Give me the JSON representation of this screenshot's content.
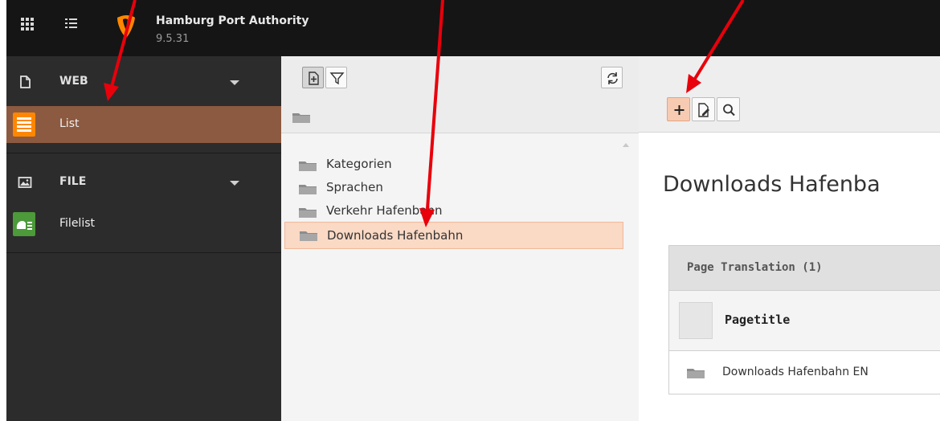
{
  "topbar": {
    "site_name": "Hamburg Port Authority",
    "version": "9.5.31"
  },
  "module_menu": {
    "groups": [
      {
        "label": "WEB",
        "icon": "document-icon",
        "modules": [
          {
            "label": "List",
            "icon": "list-module-icon",
            "active": true
          }
        ]
      },
      {
        "label": "FILE",
        "icon": "image-icon",
        "modules": [
          {
            "label": "Filelist",
            "icon": "filelist-module-icon",
            "active": false
          }
        ]
      }
    ]
  },
  "page_tree": {
    "nodes": [
      {
        "label": "Kategorien"
      },
      {
        "label": "Sprachen"
      },
      {
        "label": "Verkehr Hafenbahn"
      },
      {
        "label": "Downloads Hafenbahn",
        "selected": true
      }
    ]
  },
  "main": {
    "heading": "Downloads Hafenba",
    "panel_title": "Page Translation (1)",
    "column_title": "Pagetitle",
    "rows": [
      {
        "title": "Downloads Hafenbahn EN"
      }
    ]
  },
  "colors": {
    "accent": "#ff8700",
    "active_module": "#8c5a40",
    "selected_node": "#fad9c5",
    "annotation_arrow": "#e8000b"
  }
}
